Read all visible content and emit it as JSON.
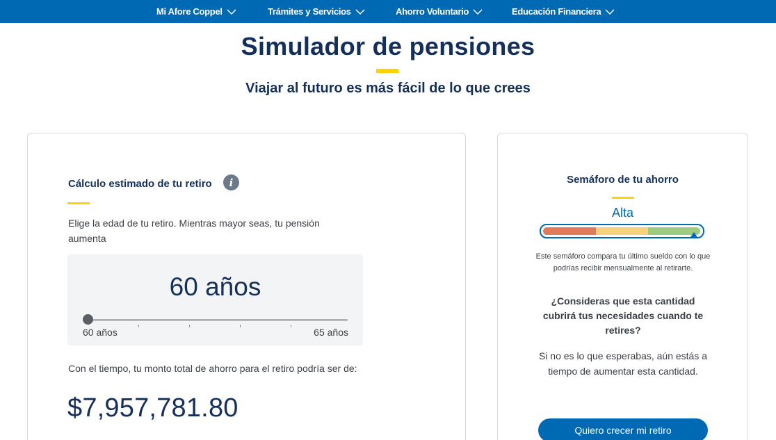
{
  "nav": {
    "items": [
      {
        "label": "Mi Afore Coppel"
      },
      {
        "label": "Trámites y Servicios"
      },
      {
        "label": "Ahorro Voluntario"
      },
      {
        "label": "Educación Financiera"
      }
    ],
    "icon": "chevron-down-icon"
  },
  "hero": {
    "title": "Simulador de pensiones",
    "subtitle": "Viajar al futuro es más fácil de lo que crees"
  },
  "calculator": {
    "title": "Cálculo estimado de tu retiro",
    "info_icon": "info-icon",
    "description": "Elige la edad de tu retiro. Mientras mayor seas, tu pensión aumenta",
    "slider": {
      "value_label": "60 años",
      "min_label": "60 años",
      "max_label": "65 años",
      "min": 60,
      "max": 65,
      "value": 60
    },
    "savings_description": "Con el tiempo, tu monto total de ahorro para el retiro podría ser de:",
    "savings_amount": "$7,957,781.80"
  },
  "semaphore": {
    "title": "Semáforo de tu ahorro",
    "level": "Alta",
    "level_fraction": 0.92,
    "note": "Este semáforo compara tu último sueldo con lo que podrías recibir mensualmente al retirarte.",
    "question": "¿Consideras que esta cantidad cubrirá tus necesidades cuando te retires?",
    "answer": "Si no es lo que esperabas, aún estás a tiempo de aumentar esta cantidad.",
    "cta_label": "Quiero crecer mi retiro",
    "colors": {
      "low": "#e07a5a",
      "medium": "#f7d27a",
      "high": "#9dcb80"
    }
  },
  "colors": {
    "primary": "#0069b4",
    "accent": "#ffd100",
    "heading": "#14305a"
  }
}
